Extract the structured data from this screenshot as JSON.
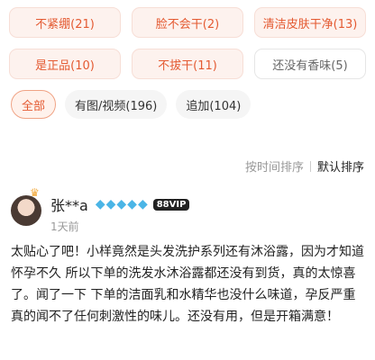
{
  "tags": [
    {
      "label": "不紧绷(21)",
      "tone": "positive"
    },
    {
      "label": "脸不会干(2)",
      "tone": "positive"
    },
    {
      "label": "清洁皮肤干净(13)",
      "tone": "positive"
    },
    {
      "label": "是正品(10)",
      "tone": "positive"
    },
    {
      "label": "不拔干(11)",
      "tone": "positive"
    },
    {
      "label": "还没有香味(5)",
      "tone": "neutral"
    }
  ],
  "filters": [
    {
      "label": "全部",
      "active": true
    },
    {
      "label": "有图/视频(196)",
      "active": false
    },
    {
      "label": "追加(104)",
      "active": false
    }
  ],
  "sort": {
    "by_time": "按时间排序",
    "default": "默认排序"
  },
  "review": {
    "username": "张**a",
    "vip": "88VIP",
    "time": "1天前",
    "content": "太贴心了吧！小样竟然是头发洗护系列还有沐浴露，因为才知道怀孕不久 所以下单的洗发水沐浴露都还没有到货，真的太惊喜了。闻了一下 下单的洁面乳和水精华也没什么味道，孕反严重真的闻不了任何刺激性的味儿。还没有用，但是开箱满意！"
  },
  "colors": {
    "accent": "#e45a32",
    "tag_bg": "#fdf2ee",
    "diamond": "#4bb5e6"
  }
}
